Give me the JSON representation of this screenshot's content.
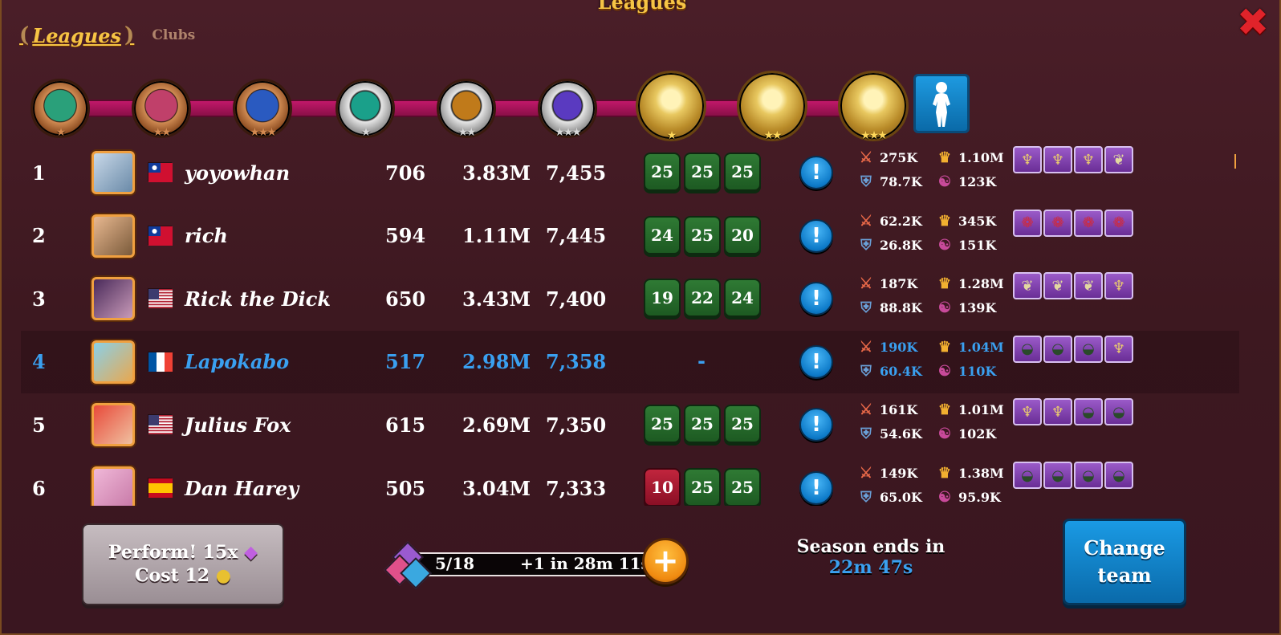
{
  "header": {
    "title": "Leagues",
    "tab_active": "Leagues",
    "tab_inactive": "Clubs",
    "close_icon": "close-icon"
  },
  "league_track": {
    "badges": [
      {
        "tier": "fist",
        "stars": "★",
        "color": "#2aa07a"
      },
      {
        "tier": "fist",
        "stars": "★★",
        "color": "#c0406a"
      },
      {
        "tier": "fist",
        "stars": "★★★",
        "color": "#2a5ac0"
      },
      {
        "tier": "blade",
        "stars": "★",
        "color": "#1aa08a"
      },
      {
        "tier": "blade",
        "stars": "★★",
        "color": "#c07a1a"
      },
      {
        "tier": "blade",
        "stars": "★★★",
        "color": "#5a3ac0"
      },
      {
        "tier": "gold",
        "stars": "★",
        "color": "#e8c860"
      },
      {
        "tier": "gold",
        "stars": "★★",
        "color": "#e8c860"
      },
      {
        "tier": "gold",
        "stars": "★★★",
        "color": "#e8c860"
      }
    ],
    "current_icon": "girl-silhouette-icon"
  },
  "players": [
    {
      "rank": "1",
      "name": "yoyowhan",
      "flag": "taiwan",
      "level": "706",
      "power": "3.83M",
      "points": "7,455",
      "scores": [
        {
          "v": "25",
          "win": true
        },
        {
          "v": "25",
          "win": true
        },
        {
          "v": "25",
          "win": true
        }
      ],
      "stats": {
        "atk": "275K",
        "ego": "1.10M",
        "def": "78.7K",
        "har": "123K"
      },
      "boosters": [
        "ginseng",
        "ginseng",
        "ginseng",
        "cordyceps"
      ],
      "avatar": [
        "#c8d8e8",
        "#6a8aa8"
      ]
    },
    {
      "rank": "2",
      "name": "rich",
      "flag": "taiwan",
      "level": "594",
      "power": "1.11M",
      "points": "7,445",
      "scores": [
        {
          "v": "24",
          "win": true
        },
        {
          "v": "25",
          "win": true
        },
        {
          "v": "20",
          "win": true
        }
      ],
      "stats": {
        "atk": "62.2K",
        "ego": "345K",
        "def": "26.8K",
        "har": "151K"
      },
      "boosters": [
        "jujubes",
        "jujubes",
        "jujubes",
        "jujubes"
      ],
      "avatar": [
        "#e8b890",
        "#7a5a3a"
      ]
    },
    {
      "rank": "3",
      "name": "Rick the Dick",
      "flag": "usa",
      "level": "650",
      "power": "3.43M",
      "points": "7,400",
      "scores": [
        {
          "v": "19",
          "win": true
        },
        {
          "v": "22",
          "win": true
        },
        {
          "v": "24",
          "win": true
        }
      ],
      "stats": {
        "atk": "187K",
        "ego": "1.28M",
        "def": "88.8K",
        "har": "139K"
      },
      "boosters": [
        "cordyceps",
        "cordyceps",
        "cordyceps",
        "ginseng"
      ],
      "avatar": [
        "#4a2a5a",
        "#c89ab8"
      ]
    },
    {
      "rank": "4",
      "name": "Lapokabo",
      "flag": "france",
      "level": "517",
      "power": "2.98M",
      "points": "7,358",
      "is_me": true,
      "dash": "-",
      "scores": [],
      "stats": {
        "atk": "190K",
        "ego": "1.04M",
        "def": "60.4K",
        "har": "110K"
      },
      "boosters": [
        "chlorella",
        "chlorella",
        "chlorella",
        "ginseng"
      ],
      "avatar": [
        "#8ad0e8",
        "#e8a850"
      ]
    },
    {
      "rank": "5",
      "name": "Julius Fox",
      "flag": "usa",
      "level": "615",
      "power": "2.69M",
      "points": "7,350",
      "scores": [
        {
          "v": "25",
          "win": true
        },
        {
          "v": "25",
          "win": true
        },
        {
          "v": "25",
          "win": true
        }
      ],
      "stats": {
        "atk": "161K",
        "ego": "1.01M",
        "def": "54.6K",
        "har": "102K"
      },
      "boosters": [
        "ginseng",
        "ginseng",
        "chlorella",
        "chlorella"
      ],
      "avatar": [
        "#e84a3a",
        "#f0c0a0"
      ]
    },
    {
      "rank": "6",
      "name": "Dan Harey",
      "flag": "spain",
      "level": "505",
      "power": "3.04M",
      "points": "7,333",
      "scores": [
        {
          "v": "10",
          "win": false
        },
        {
          "v": "25",
          "win": true
        },
        {
          "v": "25",
          "win": true
        }
      ],
      "stats": {
        "atk": "149K",
        "ego": "1.38M",
        "def": "65.0K",
        "har": "95.9K"
      },
      "boosters": [
        "chlorella",
        "chlorella",
        "chlorella",
        "chlorella"
      ],
      "avatar": [
        "#f0b8d8",
        "#c87aa8"
      ]
    }
  ],
  "footer": {
    "perform_line1": "Perform! 15x",
    "perform_line2": "Cost 12",
    "energy_count": "5/18",
    "energy_timer": "+1 in 28m 11s",
    "season_label": "Season ends in",
    "season_time": "22m 47s",
    "change_line1": "Change",
    "change_line2": "team"
  },
  "colors": {
    "accent_gold": "#f6c445",
    "self_blue": "#3aa0f0",
    "win_green": "#2f7a34",
    "lose_red": "#c1253d"
  }
}
